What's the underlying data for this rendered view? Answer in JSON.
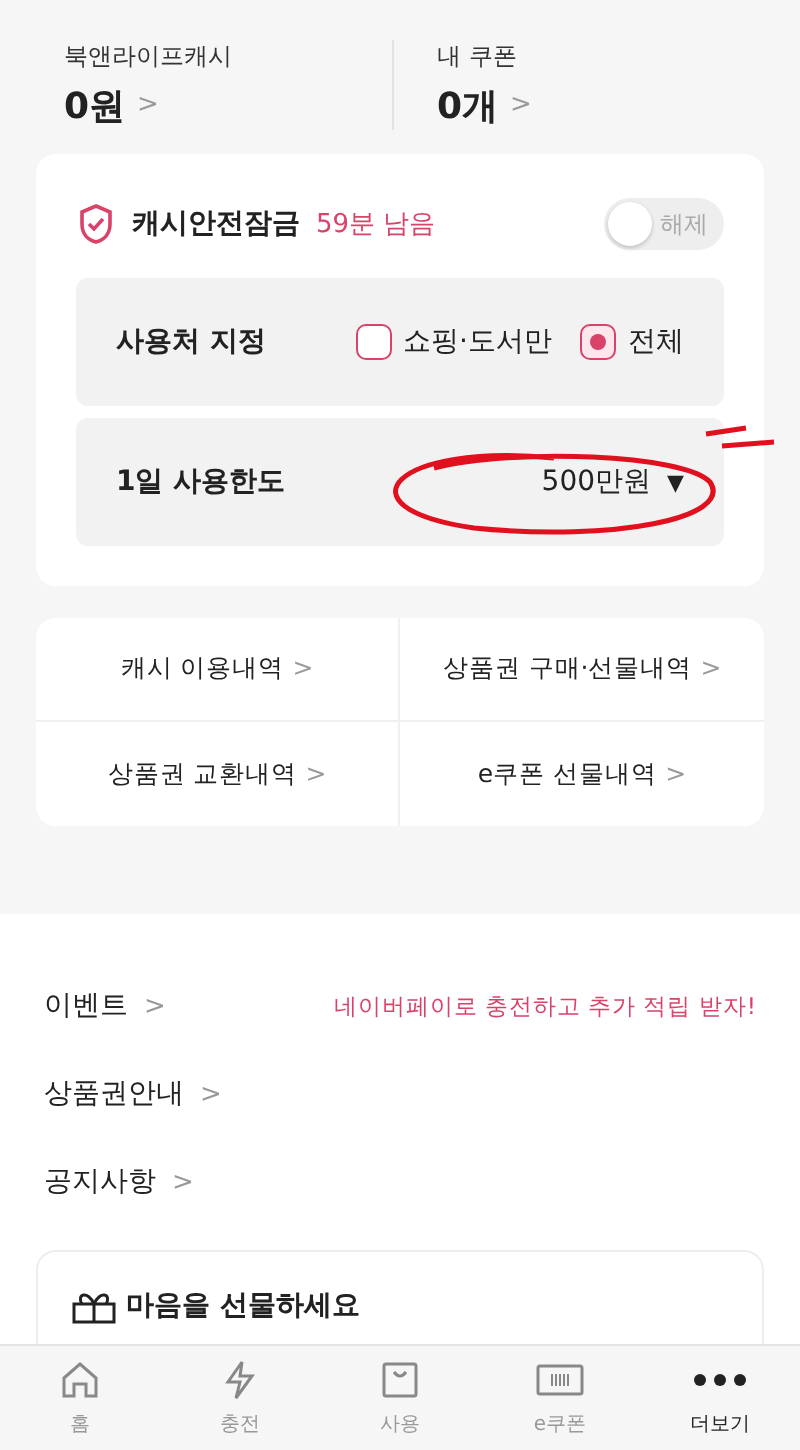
{
  "summary": [
    {
      "label": "북앤라이프캐시",
      "value": "0원",
      "chevron": ">"
    },
    {
      "label": "내 쿠폰",
      "value": "0개",
      "chevron": ">"
    }
  ],
  "lock": {
    "title": "캐시안전잠금",
    "remaining": "59분 남음",
    "toggle": {
      "label": "해제",
      "on": false
    },
    "usage": {
      "label": "사용처 지정",
      "options": [
        {
          "label": "쇼핑·도서만",
          "selected": false
        },
        {
          "label": "전체",
          "selected": true
        }
      ]
    },
    "limit": {
      "label": "1일 사용한도",
      "value": "500만원",
      "caret": "▼"
    }
  },
  "links": [
    {
      "label": "캐시 이용내역",
      "chevron": ">"
    },
    {
      "label": "상품권 구매·선물내역",
      "chevron": ">"
    },
    {
      "label": "상품권 교환내역",
      "chevron": ">"
    },
    {
      "label": "e쿠폰 선물내역",
      "chevron": ">"
    }
  ],
  "menu": [
    {
      "label": "이벤트",
      "chevron": ">",
      "promo": "네이버페이로 충전하고 추가 적립 받자!"
    },
    {
      "label": "상품권안내",
      "chevron": ">"
    },
    {
      "label": "공지사항",
      "chevron": ">"
    }
  ],
  "gift_card": {
    "title": "마음을 선물하세요"
  },
  "tab_bar": [
    {
      "kind": "home",
      "label": "홈",
      "selected": false
    },
    {
      "kind": "bolt",
      "label": "충전",
      "selected": false
    },
    {
      "kind": "bag",
      "label": "사용",
      "selected": false
    },
    {
      "kind": "ticket",
      "label": "e쿠폰",
      "selected": false
    },
    {
      "kind": "more",
      "label": "더보기",
      "selected": true
    }
  ]
}
